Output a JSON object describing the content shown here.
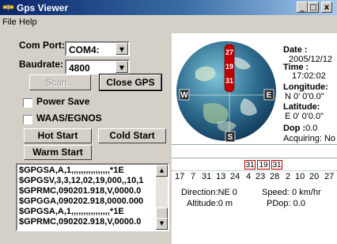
{
  "window": {
    "title": "Gps Viewer",
    "controls": {
      "minimize": "_",
      "maximize": "□",
      "close": "x"
    }
  },
  "menu": {
    "items": [
      "File",
      "Help"
    ]
  },
  "settings": {
    "com_port_label": "Com Port:",
    "com_port_value": "COM4:",
    "baudrate_label": "Baudrate:",
    "baudrate_value": "4800",
    "scan_label": "Scan...",
    "close_gps_label": "Close GPS",
    "power_save_label": "Power Save",
    "waas_label": "WAAS/EGNOS",
    "hot_start_label": "Hot Start",
    "cold_start_label": "Cold Start",
    "warm_start_label": "Warm Start"
  },
  "nmea_lines": [
    "$GPGSA,A,1,,,,,,,,,,,,,,,,*1E",
    "$GPGSV,3,3,12,02,19,000,,10,1",
    "$GPRMC,090201.918,V,0000.0",
    "$GPGGA,090202.918,0000.000",
    "$GPGSA,A,1,,,,,,,,,,,,,,,,*1E",
    "$GPRMC,090202.918,V,0000.0"
  ],
  "status": {
    "date_label": "Date :",
    "date_value": "2005/12/12",
    "time_label": "Time :",
    "time_value": "17:02:02",
    "longitude_label": "Longitude:",
    "longitude_value": "N  0' 0'0.0\"",
    "latitude_label": "Latitude:",
    "latitude_value": "E  0' 0'0.0\"",
    "dop_label": "Dop :",
    "dop_value": "0.0",
    "acquiring": "Acquiring: No Fix"
  },
  "compass": {
    "west": "W",
    "east": "E",
    "south": "S"
  },
  "globe_sats": [
    "27",
    "19",
    "31"
  ],
  "sat_ids": [
    "17",
    "7",
    "31",
    "13",
    "24",
    "4",
    "23",
    "28",
    "2",
    "10",
    "20",
    "27"
  ],
  "sat_highlight": [
    "31",
    "19",
    "31"
  ],
  "motion": {
    "direction_label": "Direction:",
    "direction_value": "NE 0",
    "speed_label": "Speed:",
    "speed_value": "0 km/hr",
    "altitude_label": "Altitude:",
    "altitude_value": "0 m",
    "pdop_label": "PDop:",
    "pdop_value": "0.0"
  },
  "colors": {
    "title_bar": "#0a246a",
    "window_bg": "#d4d0c8",
    "globe_ocean": "#2c6a8c",
    "sat_marker": "#c00000"
  }
}
